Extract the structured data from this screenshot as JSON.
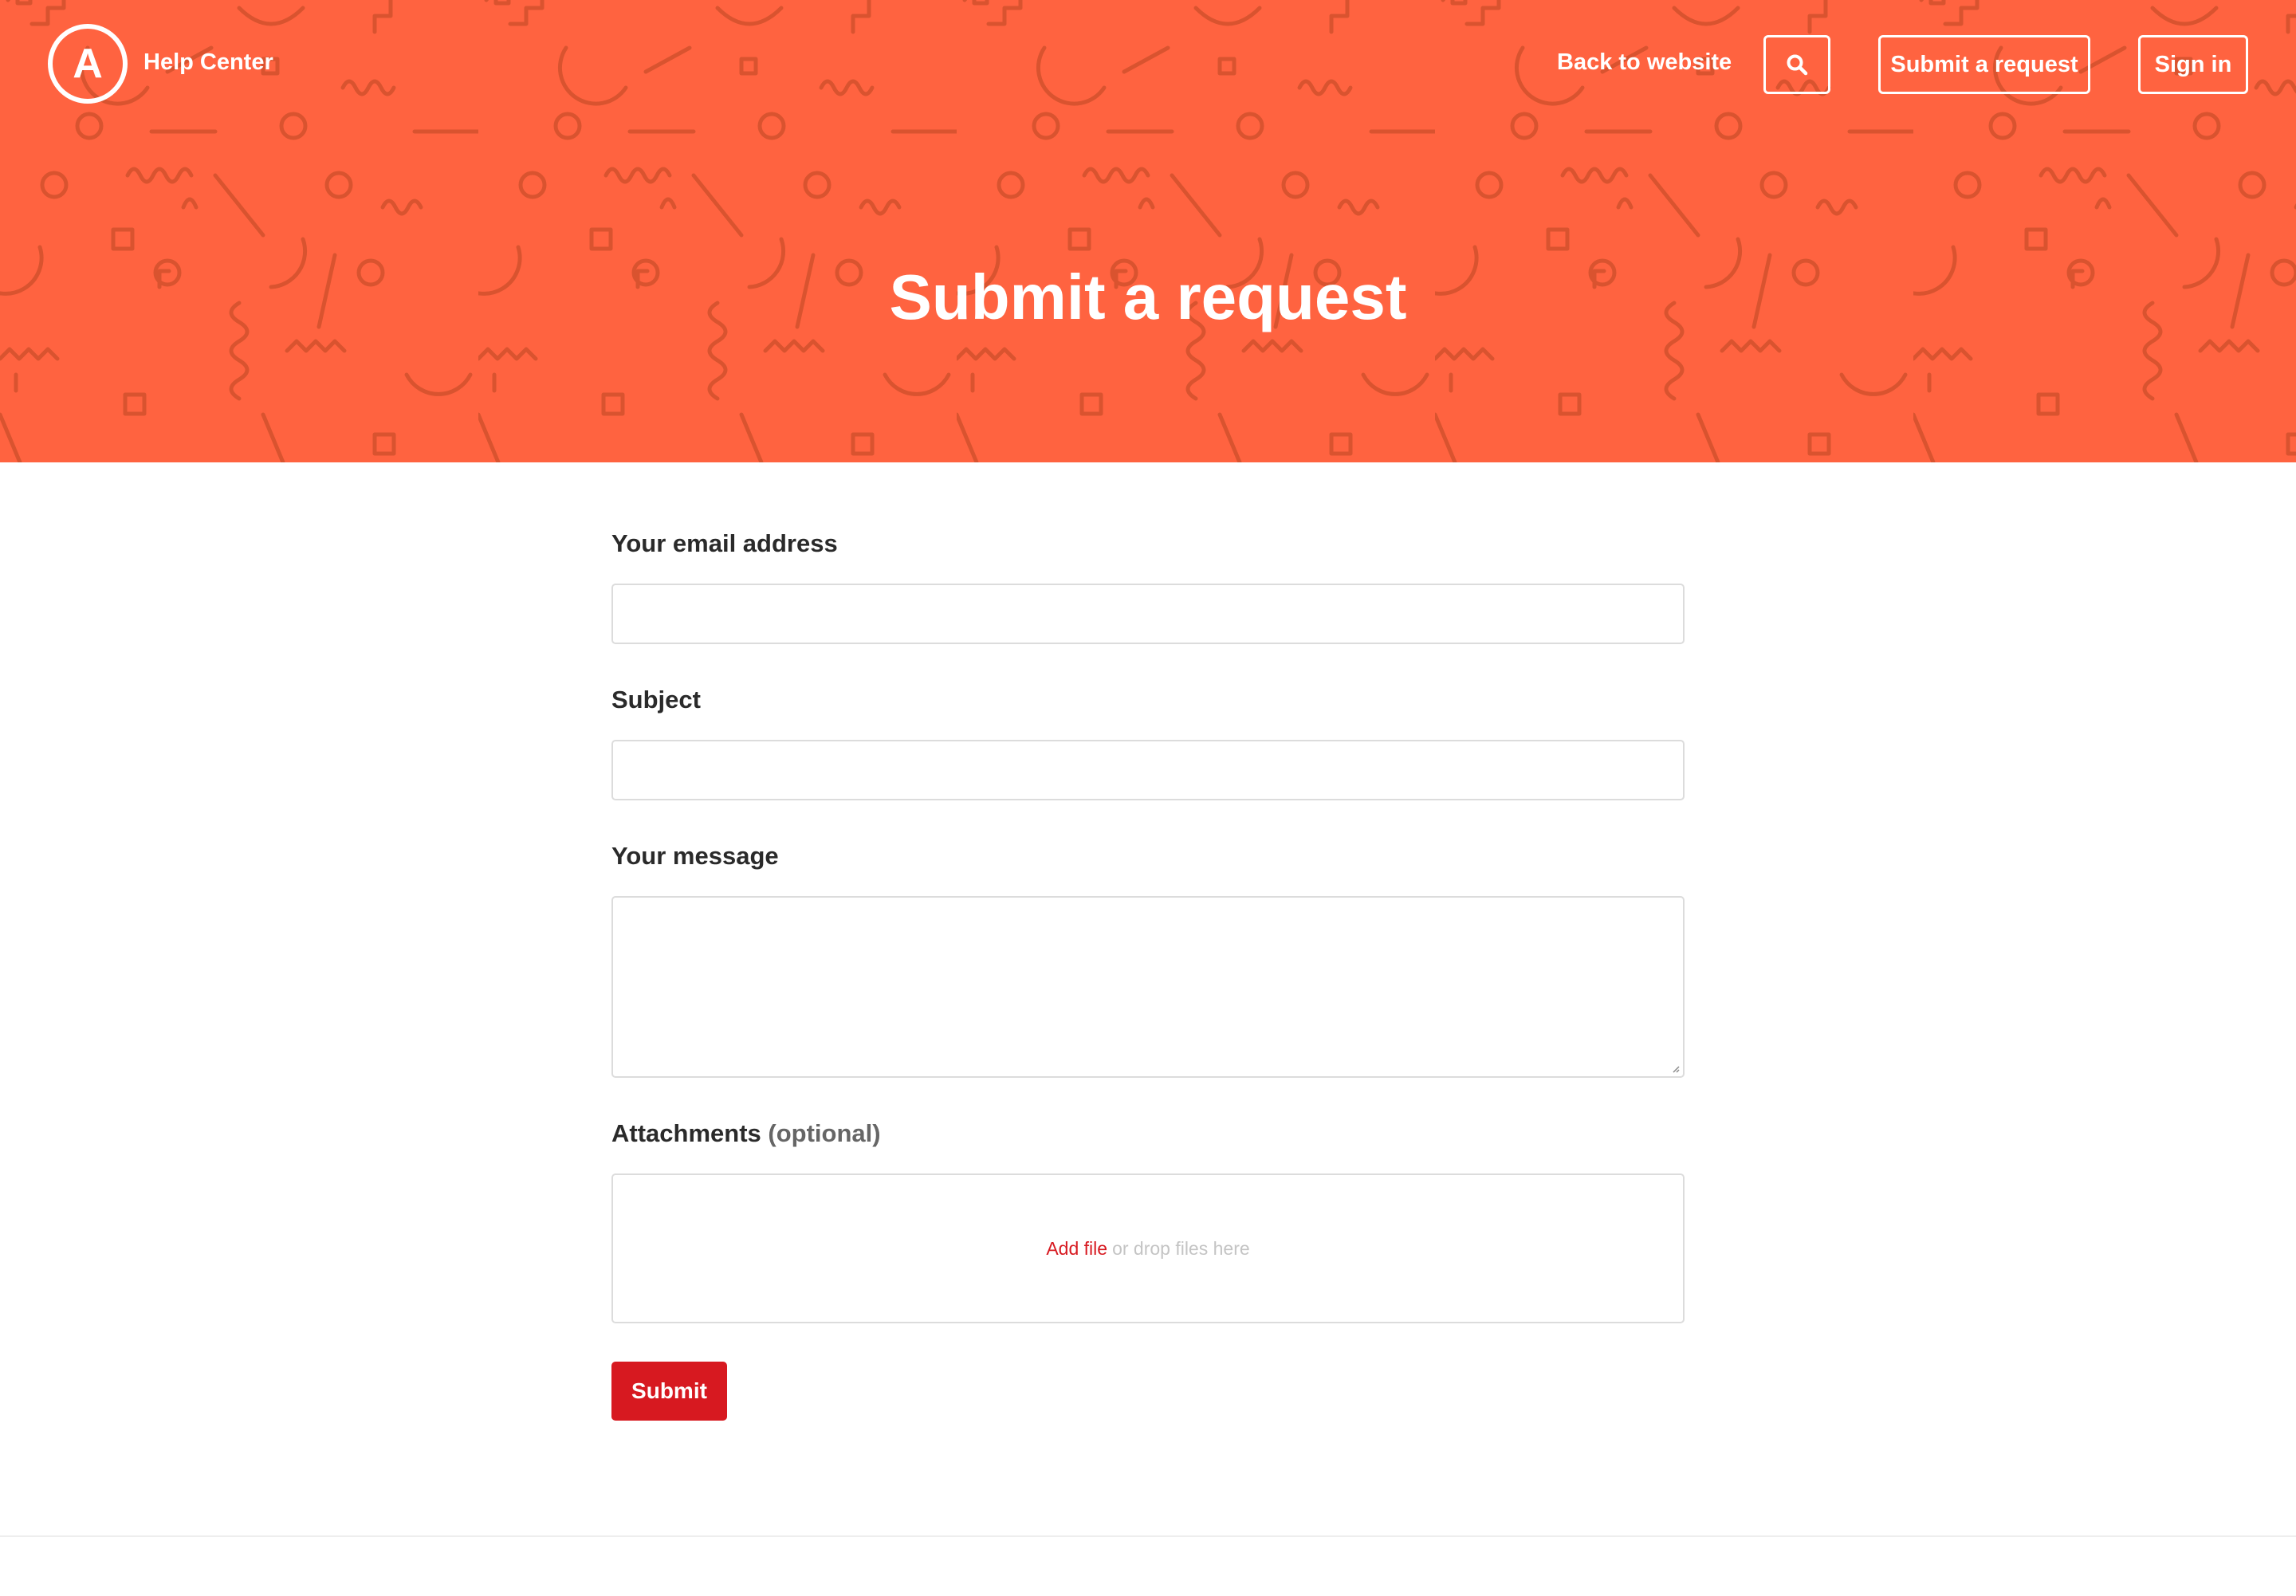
{
  "colors": {
    "hero_background": "#ff6340",
    "pattern_stroke": "#d9532f",
    "accent_red": "#d71920",
    "text_dark": "#2a2a2a",
    "optional_gray": "#666666",
    "placeholder_gray": "#c4c4c4",
    "border_gray": "#dcdcdc"
  },
  "header": {
    "logo_letter": "A",
    "brand_label": "Help Center",
    "nav": {
      "back_link": "Back to website",
      "search_icon": "search-icon",
      "submit_request": "Submit a request",
      "sign_in": "Sign in"
    }
  },
  "hero": {
    "title": "Submit a request"
  },
  "form": {
    "email": {
      "label": "Your email address",
      "value": ""
    },
    "subject": {
      "label": "Subject",
      "value": ""
    },
    "message": {
      "label": "Your message",
      "value": ""
    },
    "attachments": {
      "label": "Attachments",
      "optional": "(optional)",
      "add_file": "Add file",
      "drop_hint": "or drop files here"
    },
    "submit_label": "Submit"
  }
}
